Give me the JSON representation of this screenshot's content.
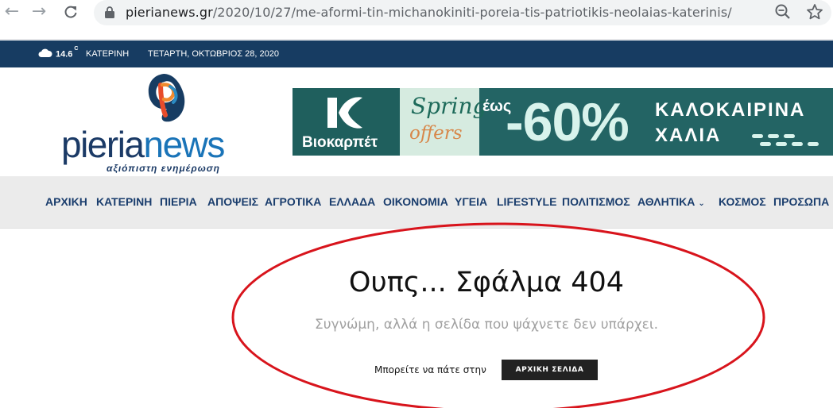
{
  "browser": {
    "url_domain": "pierianews.gr",
    "url_path": "/2020/10/27/me-aformi-tin-michanokiniti-poreia-tis-patriotikis-neolaias-katerinis/",
    "back_icon": "arrow-left-icon",
    "forward_icon": "arrow-right-icon",
    "reload_icon": "reload-icon",
    "lock_icon": "lock-icon",
    "zoom_icon": "zoom-out-icon",
    "bookmark_icon": "star-icon"
  },
  "topbar": {
    "temperature": "14.6",
    "unit": "C",
    "city": "ΚΑΤΕΡΙΝΗ",
    "date": "ΤΕΤΑΡΤΗ, ΟΚΤΩΒΡΙΟΣ 28, 2020",
    "weather_icon": "cloud-icon"
  },
  "logo": {
    "part1": "pieria",
    "part2": "news",
    "tagline": "αξιόπιστη ενημέρωση"
  },
  "banner": {
    "brand": "Bιοκαρπέτ",
    "spring": "Spring",
    "offers": "offers",
    "upto": "έως",
    "discount": "-60%",
    "line1": "ΚΑΛΟΚΑΙΡΙΝΑ",
    "line2": "ΧΑΛΙΑ"
  },
  "menu": [
    {
      "label": "ΑΡΧΙΚΗ"
    },
    {
      "label": "ΚΑΤΕΡΙΝΗ"
    },
    {
      "label": "ΠΙΕΡΙΑ"
    },
    {
      "label": "ΑΠΟΨΕΙΣ"
    },
    {
      "label": "ΑΓΡΟΤΙΚΑ"
    },
    {
      "label": "ΕΛΛΑΔΑ"
    },
    {
      "label": "ΟΙΚΟΝΟΜΙΑ"
    },
    {
      "label": "ΥΓΕΙΑ"
    },
    {
      "label": "LIFESTYLE"
    },
    {
      "label": "ΠΟΛΙΤΙΣΜΟΣ"
    },
    {
      "label": "ΑΘΛΗΤΙΚΑ"
    },
    {
      "label": "ΚΟΣΜΟΣ"
    },
    {
      "label": "ΠΡΟΣΩΠΑ"
    }
  ],
  "error": {
    "title": "Ουπς... Σφάλμα 404",
    "subtitle": "Συγνώμη, αλλά η σελίδα που ψάχνετε δεν υπάρχει.",
    "can_go": "Μπορείτε να πάτε στην",
    "home_button": "ΑΡΧΙΚΗ ΣΕΛΙΔΑ"
  },
  "colors": {
    "topbar_bg": "#173c62",
    "menu_text": "#1a3d6d",
    "logo_dark": "#1b3a66",
    "logo_light": "#1a74b8",
    "banner_bg": "#236464",
    "annotation": "#d8141c"
  }
}
